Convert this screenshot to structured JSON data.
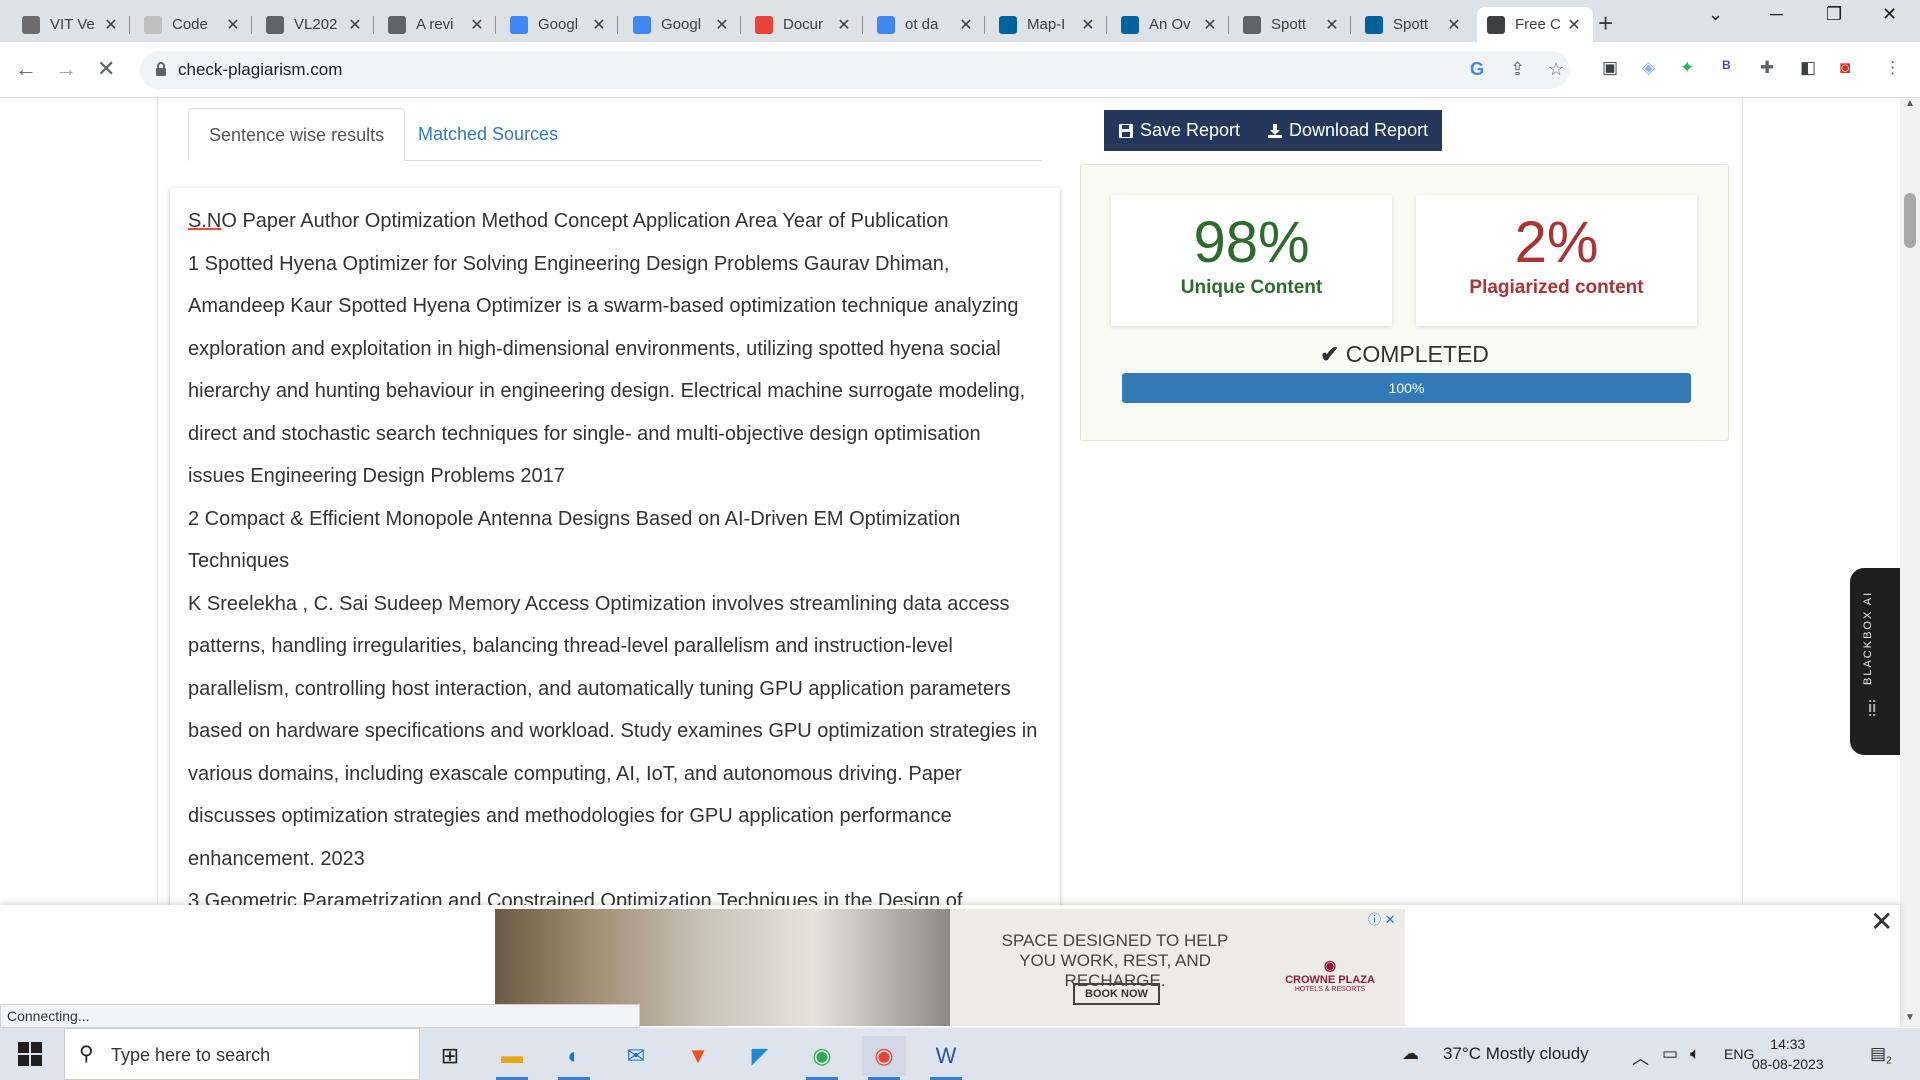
{
  "browser": {
    "tabs": [
      {
        "title": "VIT Ve",
        "icon": "vit-icon",
        "color": "#6d6d6d"
      },
      {
        "title": "Code",
        "icon": "page-icon",
        "color": "#c0c0c0"
      },
      {
        "title": "VL202",
        "icon": "globe-icon",
        "color": "#5f6368"
      },
      {
        "title": "A revi",
        "icon": "globe-icon",
        "color": "#5f6368"
      },
      {
        "title": "Googl",
        "icon": "google-docs-icon",
        "color": "#4285f4"
      },
      {
        "title": "Googl",
        "icon": "google-docs-icon",
        "color": "#4285f4"
      },
      {
        "title": "Docur",
        "icon": "gmail-icon",
        "color": "#ea4335"
      },
      {
        "title": "ot da",
        "icon": "google-docs-icon",
        "color": "#4285f4"
      },
      {
        "title": "Map-I",
        "icon": "ieee-icon",
        "color": "#00629b"
      },
      {
        "title": "An Ov",
        "icon": "ieee-icon",
        "color": "#00629b"
      },
      {
        "title": "Spott",
        "icon": "globe-icon",
        "color": "#5f6368"
      },
      {
        "title": "Spott",
        "icon": "ieee-icon",
        "color": "#00629b"
      },
      {
        "title": "Free C",
        "icon": "checklist-icon",
        "color": "#3c4043"
      }
    ],
    "url": "check-plagiarism.com"
  },
  "page": {
    "tab_sentence": "Sentence wise results",
    "tab_sources": "Matched Sources",
    "save_label": "Save Report",
    "download_label": "Download Report",
    "content": [
      {
        "lead": "S.N",
        "text": "O Paper Author Optimization Method Concept Application Area Year of Publication"
      },
      {
        "lead": "",
        "text": "1 Spotted Hyena Optimizer for Solving Engineering Design Problems Gaurav Dhiman, Amandeep Kaur  Spotted Hyena Optimizer is a swarm-based optimization technique analyzing exploration and exploitation in high-dimensional environments, utilizing spotted hyena social hierarchy and hunting behaviour in engineering design.  Electrical machine surrogate modeling, direct and stochastic search techniques for single- and multi-objective design optimisation issues Engineering Design Problems 2017"
      },
      {
        "lead": "",
        "text": " 2 Compact & Efficient Monopole Antenna Designs Based on AI-Driven EM Optimization Techniques"
      },
      {
        "lead": "",
        "text": " K Sreelekha , C. Sai Sudeep Memory Access Optimization involves streamlining data access patterns, handling irregularities, balancing thread-level parallelism and instruction-level parallelism, controlling host interaction, and automatically tuning GPU application parameters based on hardware specifications and workload.  Study examines GPU optimization strategies in various domains, including exascale computing, AI, IoT, and autonomous driving. Paper discusses optimization strategies and methodologies for GPU application performance enhancement. 2023"
      },
      {
        "lead": "",
        "text": "3 Geometric Parametrization and Constrained Optimization Techniques in the Design of"
      }
    ],
    "unique_value": "98%",
    "unique_label": "Unique Content",
    "plag_value": "2%",
    "plag_label": "Plagiarized content",
    "status_text": "COMPLETED",
    "progress_label": "100%",
    "progress_fraction": 1.0,
    "blackbox_label": "BLACKBOX AI"
  },
  "ad": {
    "headline": "SPACE DESIGNED TO HELP YOU WORK, REST, AND RECHARGE.",
    "cta": "BOOK NOW",
    "brand": "CROWNE PLAZA",
    "brand_sub": "HOTELS & RESORTS"
  },
  "statusbar": "Connecting...",
  "taskbar": {
    "search_placeholder": "Type here to search",
    "weather": "37°C  Mostly cloudy",
    "lang": "ENG",
    "time": "14:33",
    "date": "08-08-2023",
    "notif_count": "2"
  }
}
